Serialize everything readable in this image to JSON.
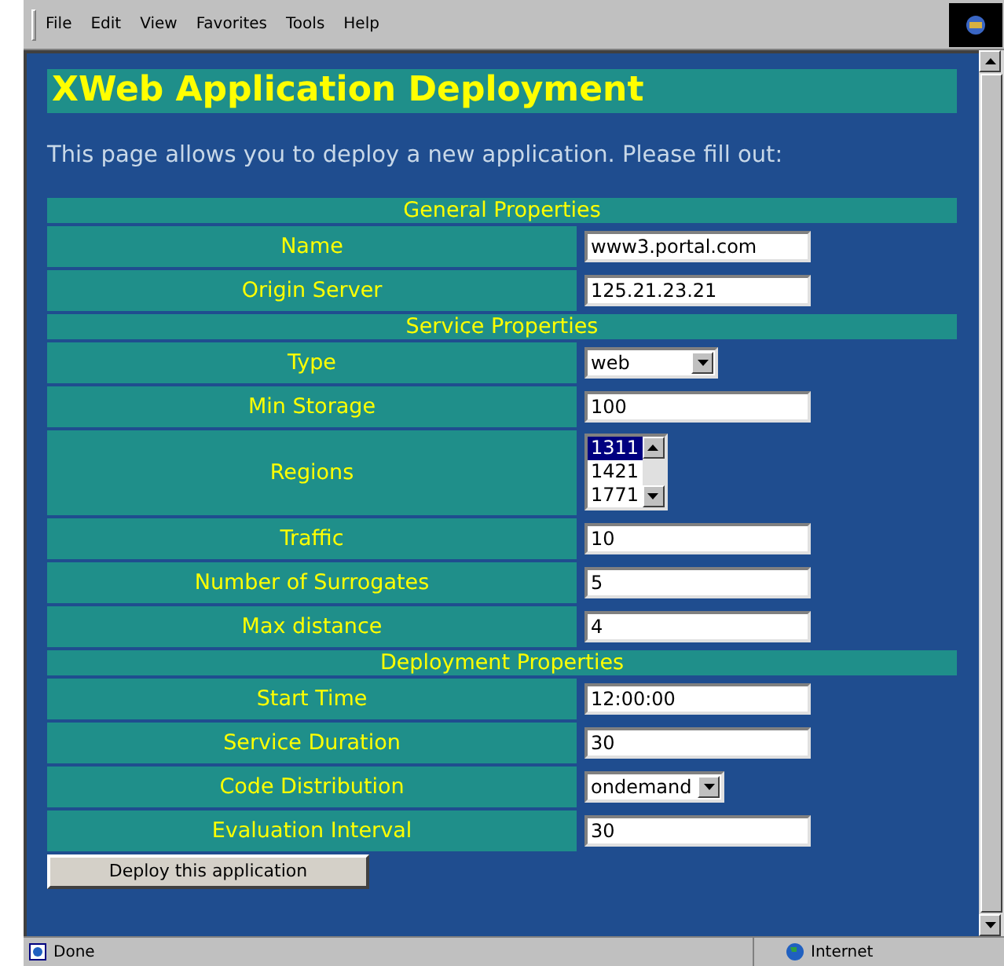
{
  "menu": [
    "File",
    "Edit",
    "View",
    "Favorites",
    "Tools",
    "Help"
  ],
  "title": "XWeb Application Deployment",
  "intro": "This page allows you to deploy a new application. Please fill out:",
  "rows": [
    {
      "kind": "section",
      "label": "General Properties"
    },
    {
      "kind": "text",
      "label": "Name",
      "value": "www3.portal.com"
    },
    {
      "kind": "text",
      "label": "Origin Server",
      "value": "125.21.23.21"
    },
    {
      "kind": "section",
      "label": "Service Properties"
    },
    {
      "kind": "select",
      "label": "Type",
      "value": "web"
    },
    {
      "kind": "text",
      "label": "Min Storage",
      "value": "100"
    },
    {
      "kind": "listbox",
      "label": "Regions",
      "options": [
        {
          "label": "1311",
          "selected": true
        },
        {
          "label": "1421",
          "selected": false
        },
        {
          "label": "1771",
          "selected": false
        }
      ]
    },
    {
      "kind": "text",
      "label": "Traffic",
      "value": "10"
    },
    {
      "kind": "text",
      "label": "Number of Surrogates",
      "value": "5"
    },
    {
      "kind": "text",
      "label": "Max distance",
      "value": "4"
    },
    {
      "kind": "section",
      "label": "Deployment Properties"
    },
    {
      "kind": "text",
      "label": "Start Time",
      "value": "12:00:00"
    },
    {
      "kind": "text",
      "label": "Service Duration",
      "value": "30"
    },
    {
      "kind": "select",
      "label": "Code Distribution",
      "value": "ondemand"
    },
    {
      "kind": "text",
      "label": "Evaluation Interval",
      "value": "30"
    }
  ],
  "button": "Deploy this application",
  "status": {
    "text": "Done",
    "zone": "Internet"
  }
}
